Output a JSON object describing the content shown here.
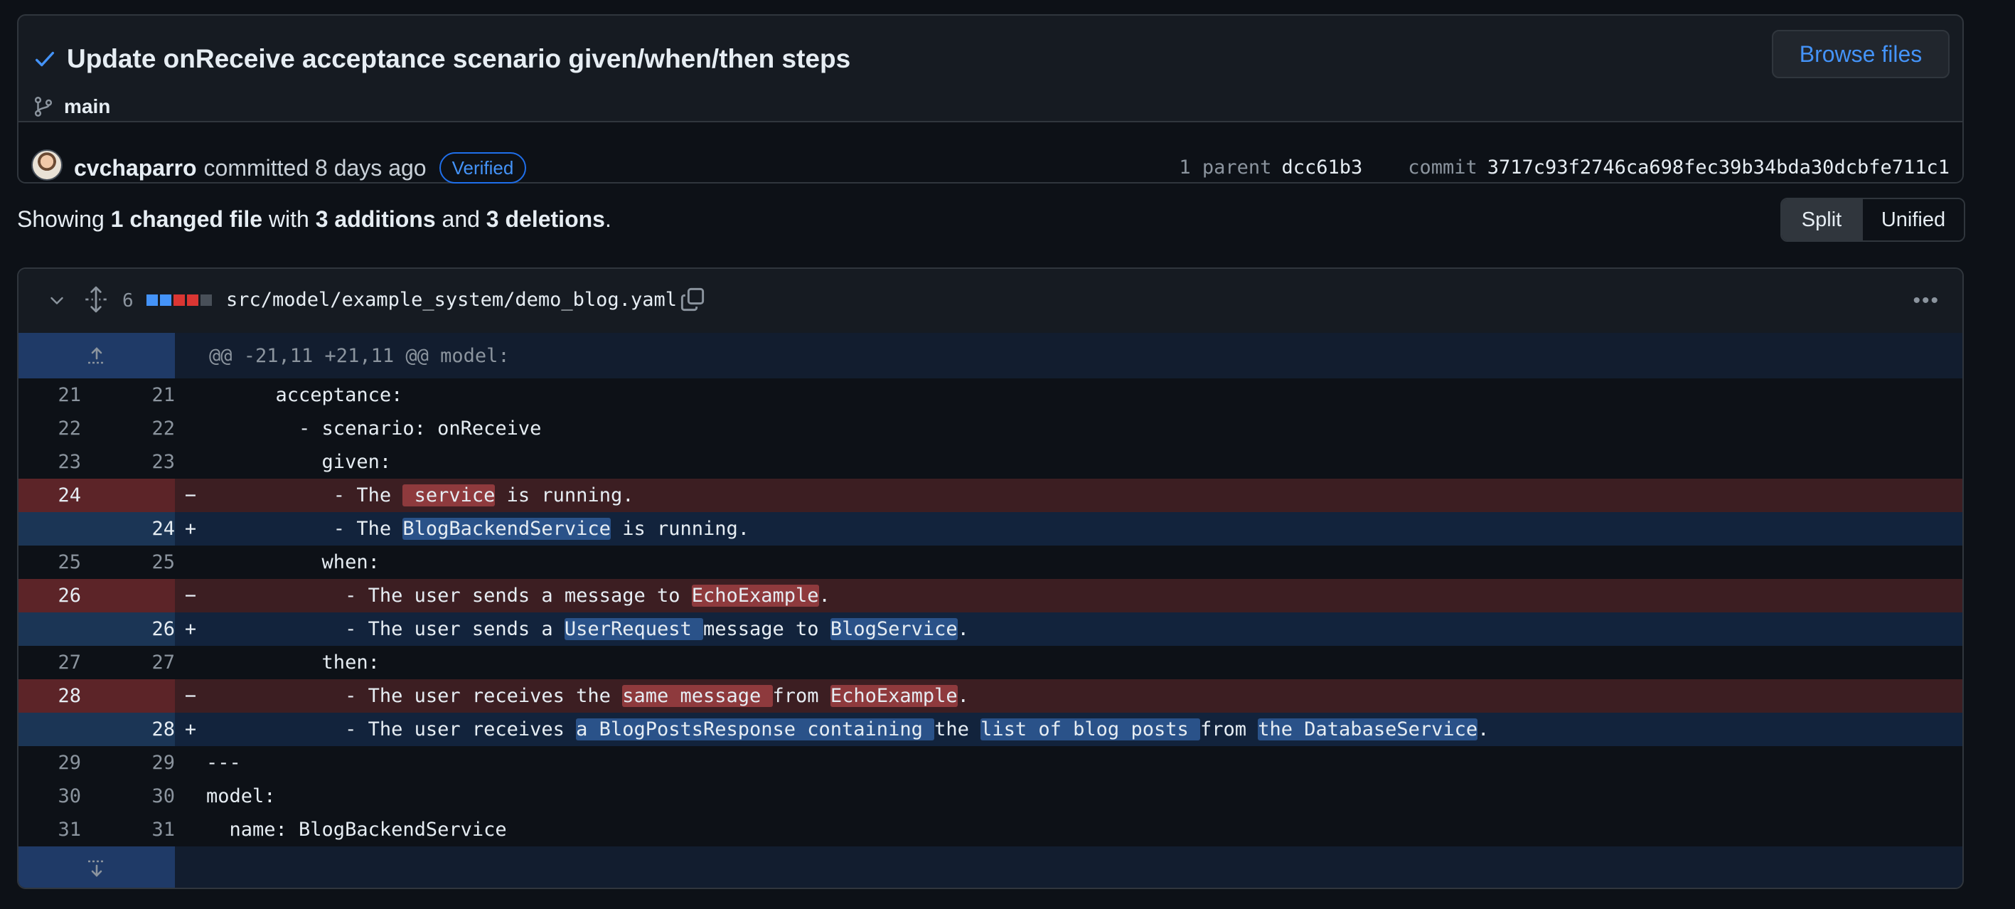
{
  "commit": {
    "title": "Update onReceive acceptance scenario given/when/then steps",
    "branch": "main",
    "browse_label": "Browse files",
    "author": "cvchaparro",
    "action": "committed 8 days ago",
    "verified": "Verified",
    "parent_label": "1 parent",
    "parent_sha": "dcc61b3",
    "commit_label": "commit",
    "sha": "3717c93f2746ca698fec39b34bda30dcbfe711c1"
  },
  "summary": {
    "prefix": "Showing",
    "files": "1 changed file",
    "with": "with",
    "additions": "3 additions",
    "and": "and",
    "deletions": "3 deletions",
    "suffix": "."
  },
  "view": {
    "split": "Split",
    "unified": "Unified"
  },
  "file": {
    "changes": "6",
    "path": "src/model/example_system/demo_blog.yaml",
    "hunk": "@@ -21,11 +21,11 @@ model:",
    "diffstat_colors": [
      "#4493f8",
      "#4493f8",
      "#da3633",
      "#da3633",
      "#484f58"
    ]
  },
  "lines": [
    {
      "type": "ctx",
      "old": "21",
      "new": "21",
      "segs": [
        {
          "t": "      acceptance:"
        }
      ]
    },
    {
      "type": "ctx",
      "old": "22",
      "new": "22",
      "segs": [
        {
          "t": "        - scenario: onReceive"
        }
      ]
    },
    {
      "type": "ctx",
      "old": "23",
      "new": "23",
      "segs": [
        {
          "t": "          given:"
        }
      ]
    },
    {
      "type": "del",
      "old": "24",
      "new": "",
      "segs": [
        {
          "t": "           - The "
        },
        {
          "t": " service",
          "h": 1
        },
        {
          "t": " is running."
        }
      ]
    },
    {
      "type": "add",
      "old": "",
      "new": "24",
      "segs": [
        {
          "t": "           - The "
        },
        {
          "t": "BlogBackendService",
          "h": 1
        },
        {
          "t": " is running."
        }
      ]
    },
    {
      "type": "ctx",
      "old": "25",
      "new": "25",
      "segs": [
        {
          "t": "          when:"
        }
      ]
    },
    {
      "type": "del",
      "old": "26",
      "new": "",
      "segs": [
        {
          "t": "            - The user sends a message to "
        },
        {
          "t": "EchoExample",
          "h": 1
        },
        {
          "t": "."
        }
      ]
    },
    {
      "type": "add",
      "old": "",
      "new": "26",
      "segs": [
        {
          "t": "            - The user sends a "
        },
        {
          "t": "UserRequest ",
          "h": 1
        },
        {
          "t": "message to "
        },
        {
          "t": "BlogService",
          "h": 1
        },
        {
          "t": "."
        }
      ]
    },
    {
      "type": "ctx",
      "old": "27",
      "new": "27",
      "segs": [
        {
          "t": "          then:"
        }
      ]
    },
    {
      "type": "del",
      "old": "28",
      "new": "",
      "segs": [
        {
          "t": "            - The user receives the "
        },
        {
          "t": "same message ",
          "h": 1
        },
        {
          "t": "from "
        },
        {
          "t": "EchoExample",
          "h": 1
        },
        {
          "t": "."
        }
      ]
    },
    {
      "type": "add",
      "old": "",
      "new": "28",
      "segs": [
        {
          "t": "            - The user receives "
        },
        {
          "t": "a BlogPostsResponse containing ",
          "h": 1
        },
        {
          "t": "the "
        },
        {
          "t": "list of blog posts ",
          "h": 1
        },
        {
          "t": "from "
        },
        {
          "t": "the DatabaseService",
          "h": 1
        },
        {
          "t": "."
        }
      ]
    },
    {
      "type": "ctx",
      "old": "29",
      "new": "29",
      "segs": [
        {
          "t": "---"
        }
      ]
    },
    {
      "type": "ctx",
      "old": "30",
      "new": "30",
      "segs": [
        {
          "t": "model:"
        }
      ]
    },
    {
      "type": "ctx",
      "old": "31",
      "new": "31",
      "segs": [
        {
          "t": "  name: BlogBackendService"
        }
      ]
    }
  ]
}
